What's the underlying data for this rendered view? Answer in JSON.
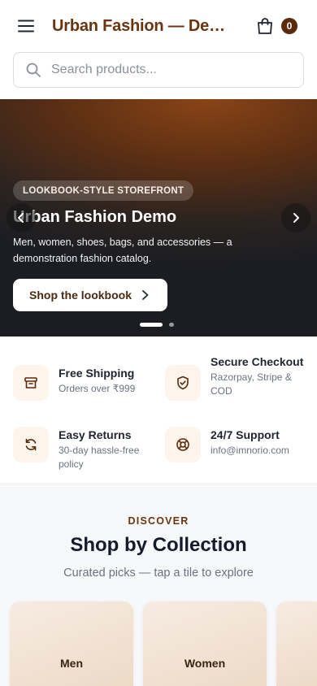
{
  "header": {
    "brand": "Urban Fashion — Demo",
    "cart_count": "0"
  },
  "search": {
    "placeholder": "Search products..."
  },
  "hero": {
    "tag": "LOOKBOOK-STYLE STOREFRONT",
    "title": "Urban Fashion Demo",
    "subtitle": "Men, women, shoes, bags, and accessories — a demonstration fashion catalog.",
    "cta_label": "Shop the lookbook",
    "slide_count": 2,
    "active_slide": 1
  },
  "features": [
    {
      "icon": "box-icon",
      "title": "Free Shipping",
      "desc": "Orders over ₹999"
    },
    {
      "icon": "shield-check-icon",
      "title": "Secure Checkout",
      "desc": "Razorpay, Stripe & COD"
    },
    {
      "icon": "refresh-icon",
      "title": "Easy Returns",
      "desc": "30-day hassle-free policy"
    },
    {
      "icon": "lifebuoy-icon",
      "title": "24/7 Support",
      "desc": "info@imnorio.com"
    }
  ],
  "collections": {
    "eyebrow": "DISCOVER",
    "title": "Shop by Collection",
    "subtitle": "Curated picks — tap a tile to explore",
    "tiles": [
      {
        "label": "Men"
      },
      {
        "label": "Women"
      },
      {
        "label": ""
      }
    ]
  },
  "colors": {
    "brand": "#6b3410",
    "badge": "#5b2a0a",
    "icon_bg": "#fdf4ec"
  }
}
